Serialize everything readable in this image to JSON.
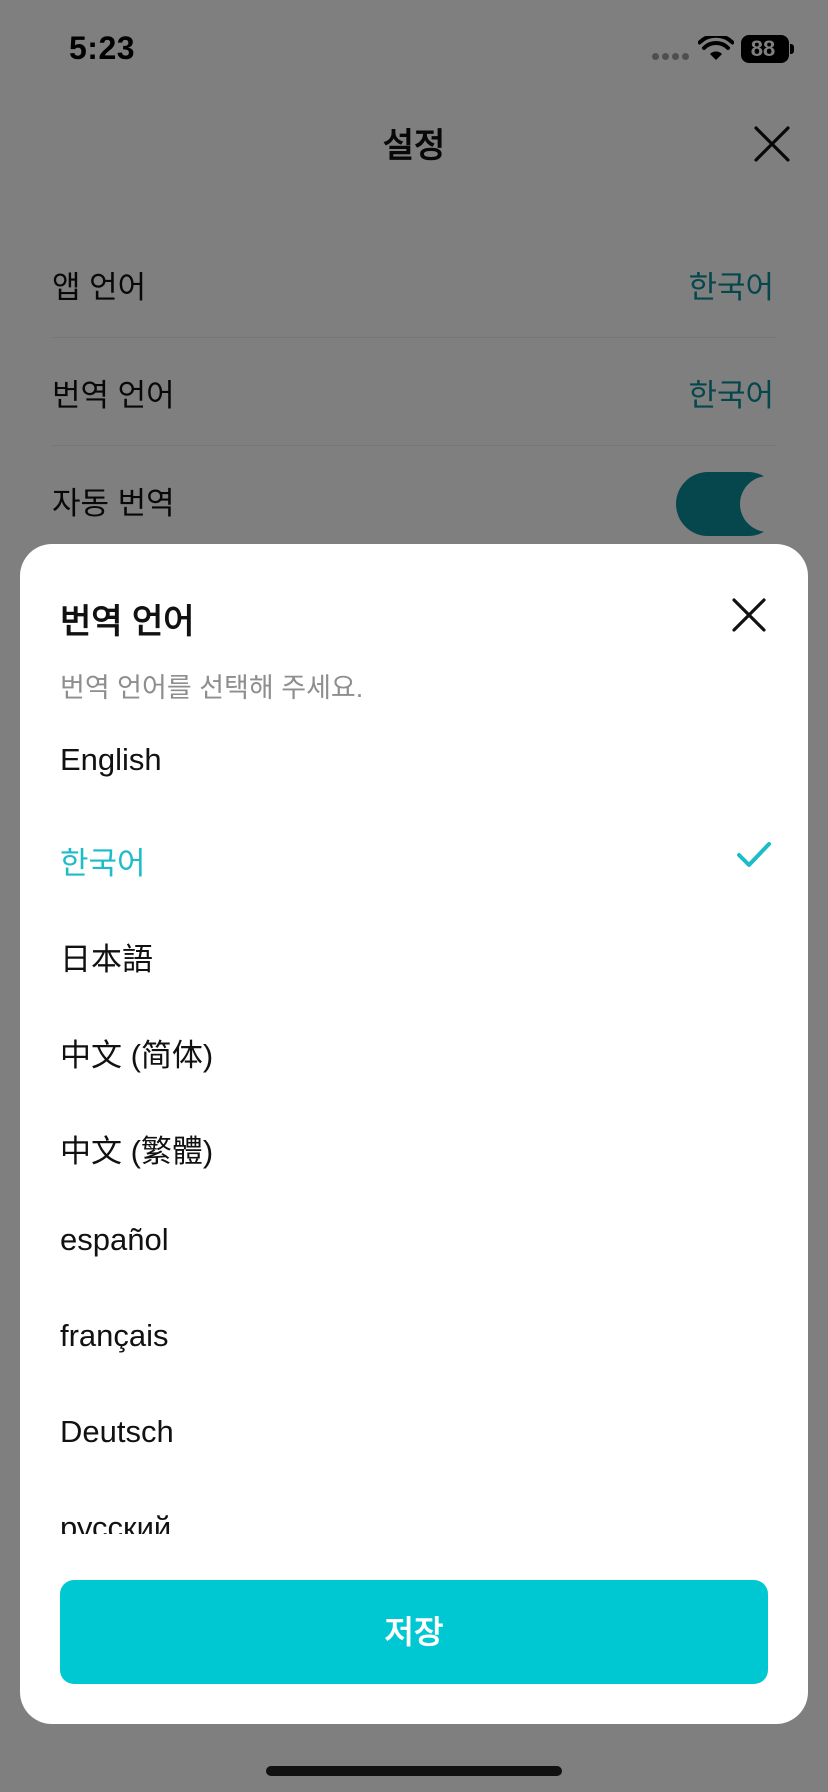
{
  "status_bar": {
    "time": "5:23",
    "battery": "88"
  },
  "header": {
    "title": "설정"
  },
  "settings": [
    {
      "label": "앱 언어",
      "value": "한국어"
    },
    {
      "label": "번역 언어",
      "value": "한국어"
    },
    {
      "label": "자동 번역",
      "toggle_on": true
    }
  ],
  "sheet": {
    "title": "번역 언어",
    "subtitle": "번역 언어를 선택해 주세요.",
    "languages": [
      "English",
      "한국어",
      "日本語",
      "中文 (简体)",
      "中文 (繁體)",
      "español",
      "français",
      "Deutsch",
      "русский"
    ],
    "selected": "한국어",
    "save_label": "저장"
  },
  "colors": {
    "accent": "#00c8d2",
    "accent_text": "#1cbcc8",
    "value_text": "#0a8f99"
  }
}
